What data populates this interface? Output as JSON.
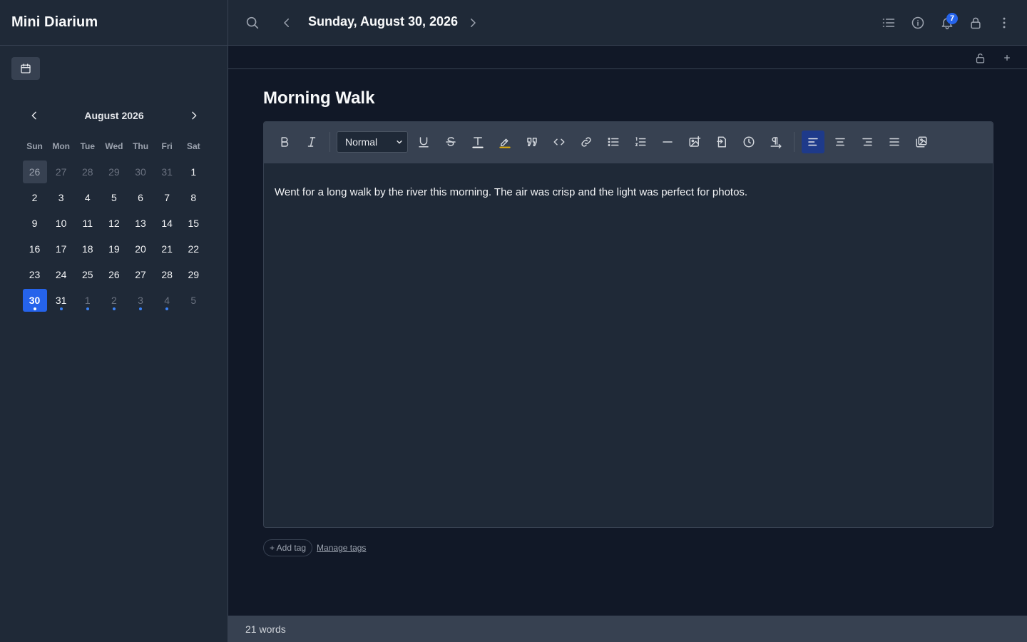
{
  "app": {
    "title": "Mini Diarium"
  },
  "header": {
    "date": "Sunday, August 30, 2026",
    "notification_count": "7"
  },
  "calendar": {
    "month_label": "August 2026",
    "weekdays": [
      "Sun",
      "Mon",
      "Tue",
      "Wed",
      "Thu",
      "Fri",
      "Sat"
    ],
    "days": [
      {
        "d": "26",
        "other": true,
        "entry": false
      },
      {
        "d": "27",
        "other": true,
        "entry": false
      },
      {
        "d": "28",
        "other": true,
        "entry": false
      },
      {
        "d": "29",
        "other": true,
        "entry": false
      },
      {
        "d": "30",
        "other": true,
        "entry": false
      },
      {
        "d": "31",
        "other": true,
        "entry": false
      },
      {
        "d": "1",
        "other": false,
        "entry": false
      },
      {
        "d": "2",
        "other": false,
        "entry": false
      },
      {
        "d": "3",
        "other": false,
        "entry": false
      },
      {
        "d": "4",
        "other": false,
        "entry": false
      },
      {
        "d": "5",
        "other": false,
        "entry": false
      },
      {
        "d": "6",
        "other": false,
        "entry": false
      },
      {
        "d": "7",
        "other": false,
        "entry": false
      },
      {
        "d": "8",
        "other": false,
        "entry": false
      },
      {
        "d": "9",
        "other": false,
        "entry": false
      },
      {
        "d": "10",
        "other": false,
        "entry": false
      },
      {
        "d": "11",
        "other": false,
        "entry": false
      },
      {
        "d": "12",
        "other": false,
        "entry": false
      },
      {
        "d": "13",
        "other": false,
        "entry": false
      },
      {
        "d": "14",
        "other": false,
        "entry": false
      },
      {
        "d": "15",
        "other": false,
        "entry": false
      },
      {
        "d": "16",
        "other": false,
        "entry": false
      },
      {
        "d": "17",
        "other": false,
        "entry": false
      },
      {
        "d": "18",
        "other": false,
        "entry": false
      },
      {
        "d": "19",
        "other": false,
        "entry": false
      },
      {
        "d": "20",
        "other": false,
        "entry": false
      },
      {
        "d": "21",
        "other": false,
        "entry": false
      },
      {
        "d": "22",
        "other": false,
        "entry": false
      },
      {
        "d": "23",
        "other": false,
        "entry": false
      },
      {
        "d": "24",
        "other": false,
        "entry": false
      },
      {
        "d": "25",
        "other": false,
        "entry": false
      },
      {
        "d": "26",
        "other": false,
        "entry": false
      },
      {
        "d": "27",
        "other": false,
        "entry": false
      },
      {
        "d": "28",
        "other": false,
        "entry": false
      },
      {
        "d": "29",
        "other": false,
        "entry": false
      },
      {
        "d": "30",
        "other": false,
        "entry": true,
        "today": true
      },
      {
        "d": "31",
        "other": false,
        "entry": true
      },
      {
        "d": "1",
        "other": true,
        "entry": true
      },
      {
        "d": "2",
        "other": true,
        "entry": true
      },
      {
        "d": "3",
        "other": true,
        "entry": true
      },
      {
        "d": "4",
        "other": true,
        "entry": true
      },
      {
        "d": "5",
        "other": true,
        "entry": false
      }
    ]
  },
  "entry": {
    "title": "Morning Walk",
    "body": "Went for a long walk by the river this morning. The air was crisp and the light was perfect for photos."
  },
  "toolbar": {
    "format_value": "Normal",
    "buttons": [
      "bold-icon",
      "italic-icon",
      "underline-icon",
      "strikethrough-icon",
      "text-color-icon",
      "highlight-icon",
      "quote-icon",
      "code-icon",
      "link-icon",
      "bullet-list-icon",
      "ordered-list-icon",
      "horizontal-rule-icon",
      "insert-image-icon",
      "import-icon",
      "timestamp-icon",
      "text-direction-icon",
      "align-left-icon",
      "align-center-icon",
      "align-right-icon",
      "justify-icon",
      "gallery-icon"
    ],
    "active": "align-left-icon"
  },
  "tags": {
    "add_label": "+ Add tag",
    "manage_label": "Manage tags"
  },
  "status": {
    "word_count": "21 words"
  },
  "colors": {
    "accent": "#2563eb",
    "sidebar_bg": "#1f2937",
    "main_bg": "#111827",
    "toolbar_bg": "#374151",
    "highlight_yellow": "#eab308"
  }
}
